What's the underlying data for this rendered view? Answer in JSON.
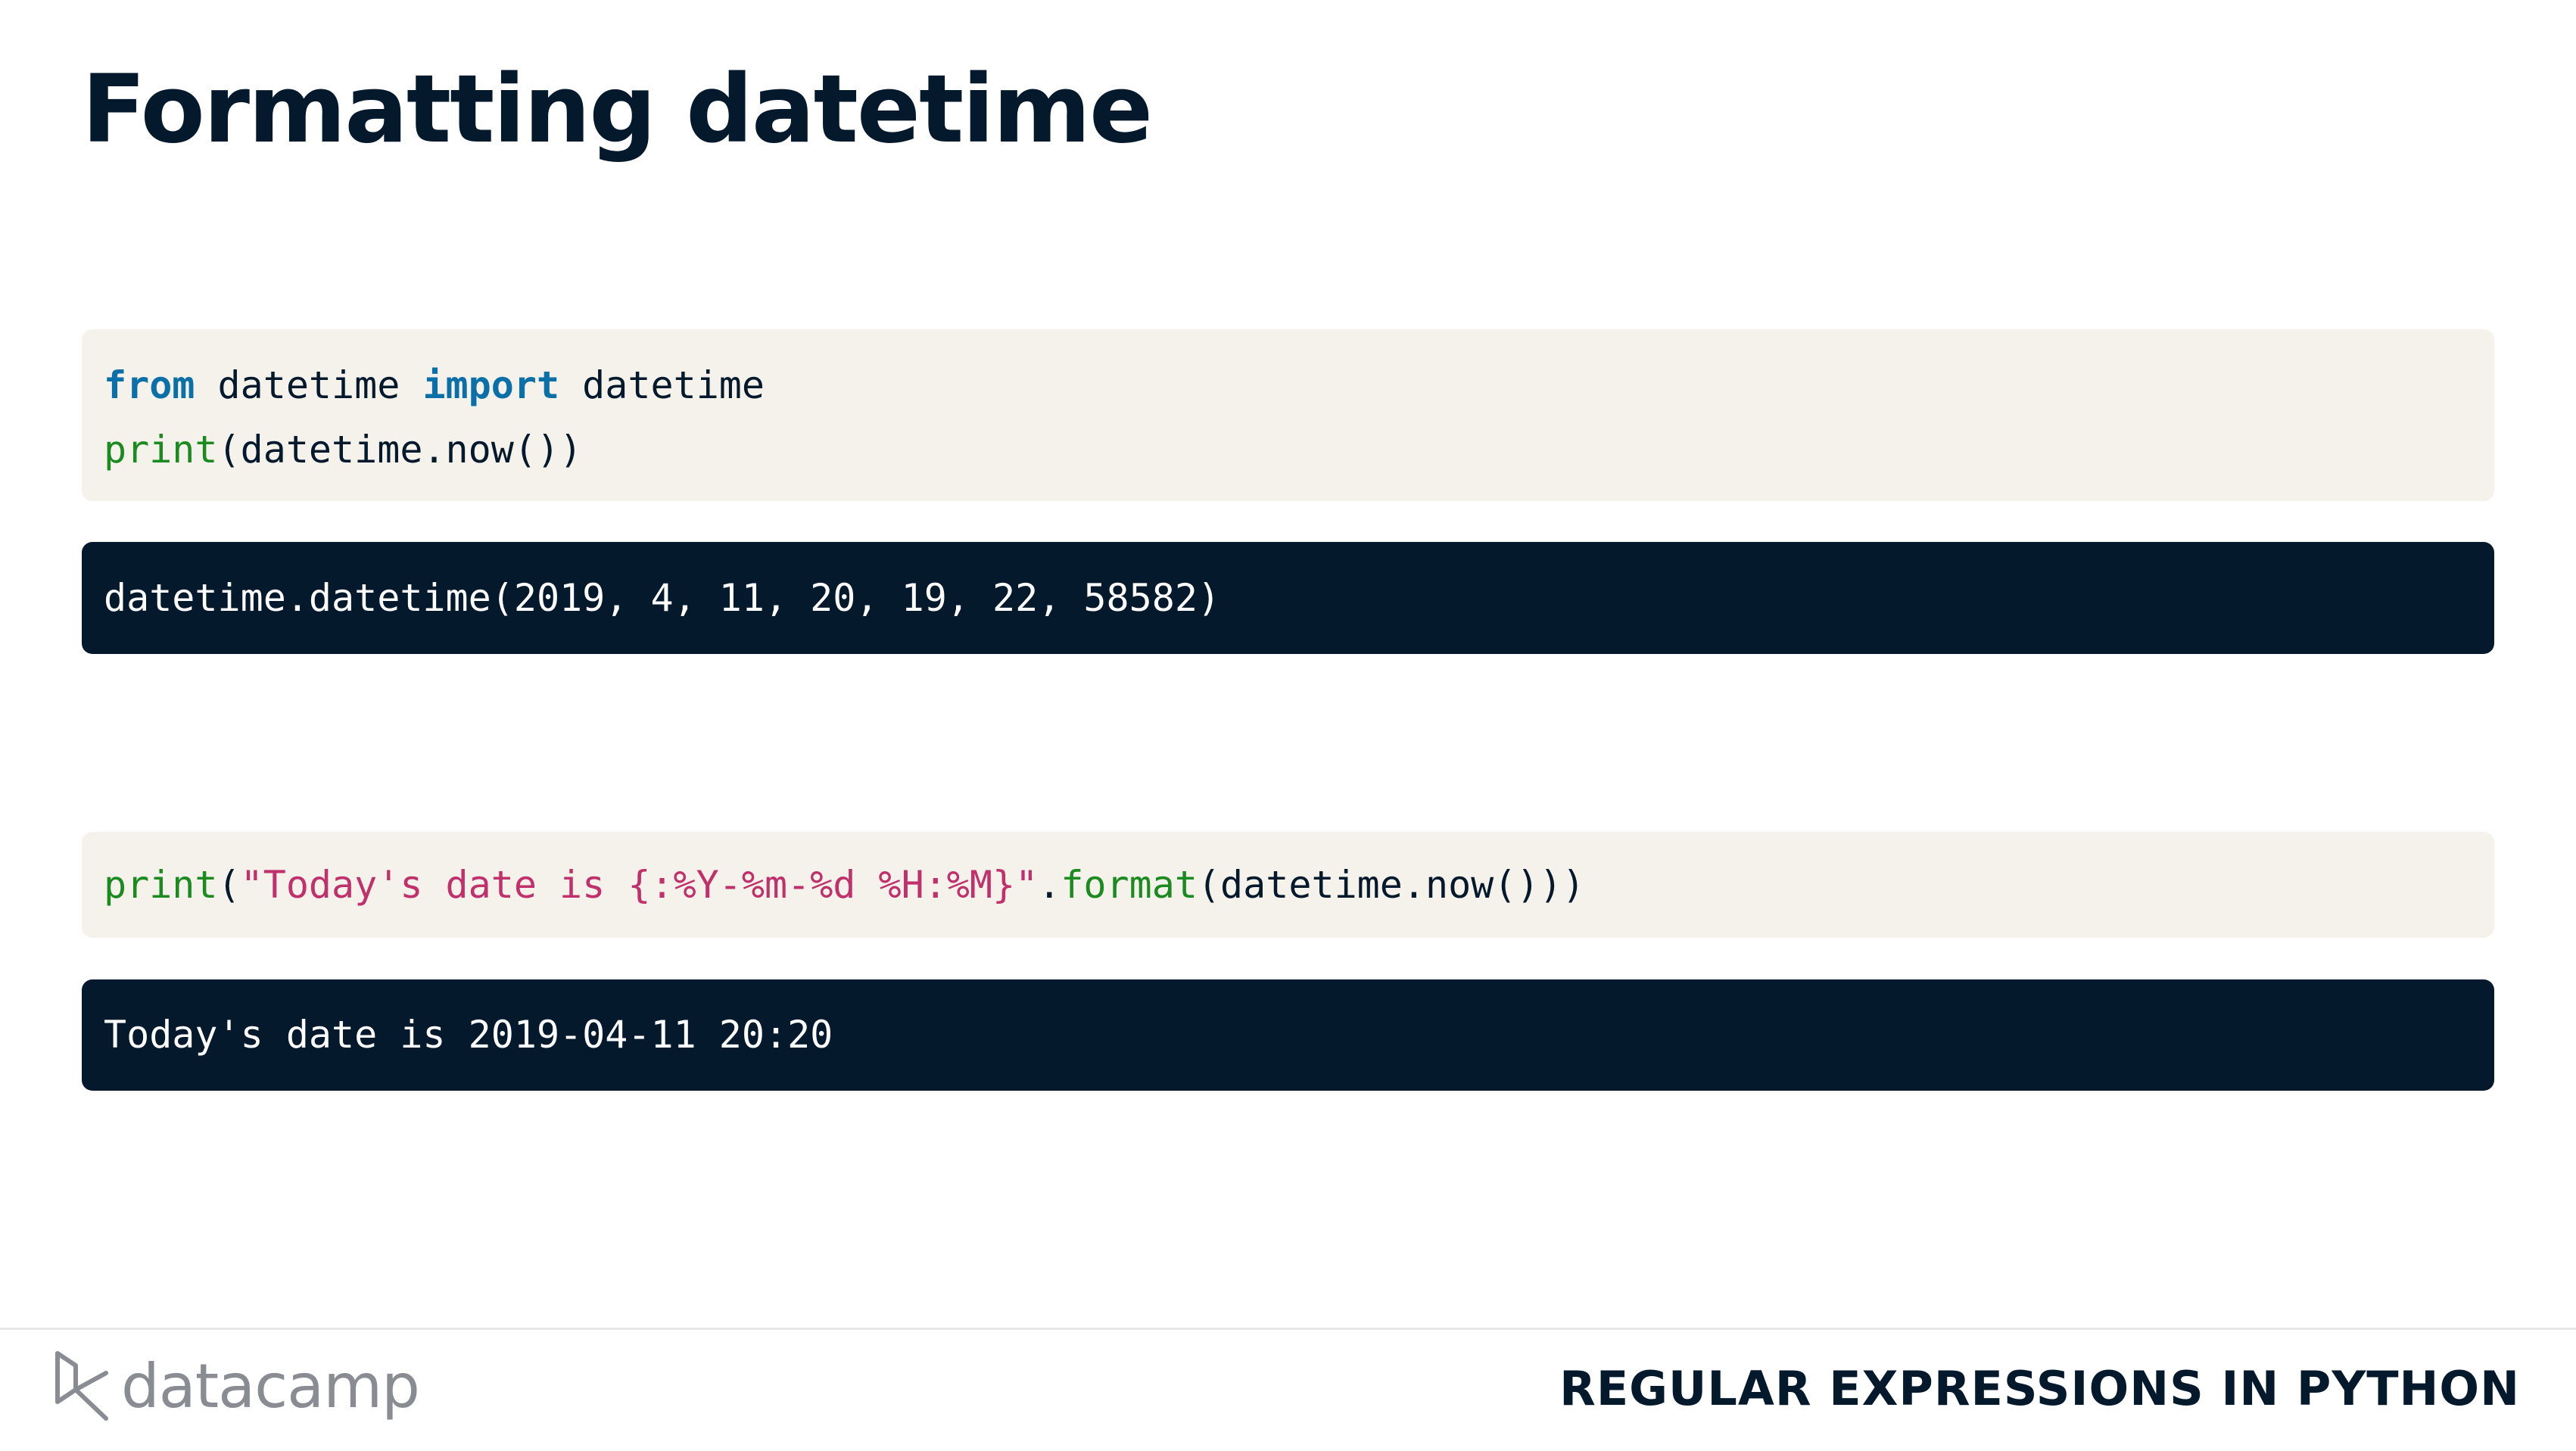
{
  "slide": {
    "title": "Formatting datetime"
  },
  "code_block_1": {
    "line_1": {
      "kw_from": "from",
      "mod": " datetime ",
      "kw_import": "import",
      "name": " datetime"
    },
    "line_2": {
      "fn_print": "print",
      "rest": "(datetime.now())"
    }
  },
  "output_block_1": {
    "text": "datetime.datetime(2019, 4, 11, 20, 19, 22, 58582)"
  },
  "code_block_2": {
    "fn_print": "print",
    "open_paren": "(",
    "string": "\"Today's date is {:%Y-%m-%d %H:%M}\"",
    "dot": ".",
    "fn_format": "format",
    "rest": "(datetime.now()))"
  },
  "output_block_2": {
    "text": "Today's date is 2019-04-11 20:20"
  },
  "footer": {
    "logo_text": "datacamp",
    "course_title": "REGULAR EXPRESSIONS IN PYTHON"
  },
  "colors": {
    "title": "#05192d",
    "code_bg": "#f5f2eb",
    "output_bg": "#05192d",
    "keyword": "#0b6fa8",
    "function": "#1b8a1f",
    "string": "#c0306a",
    "logo": "#8a8c94"
  },
  "icons": {
    "logo": "datacamp-logo-icon"
  }
}
